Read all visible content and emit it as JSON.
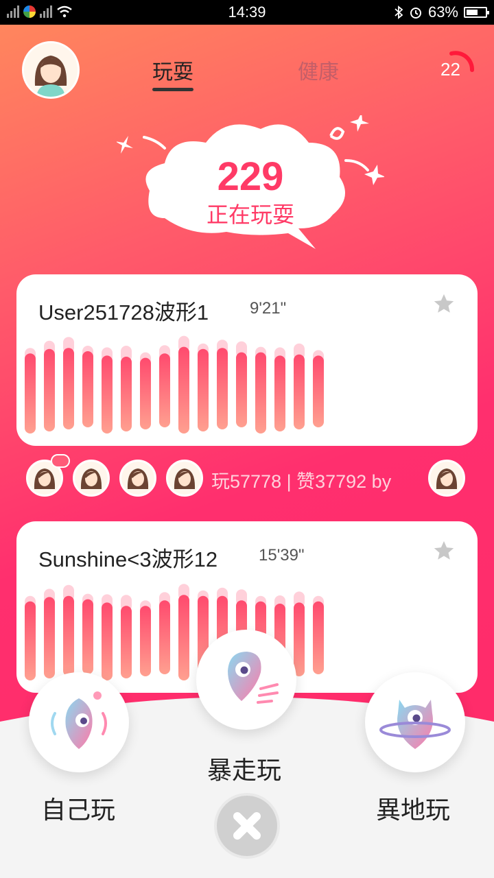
{
  "status_bar": {
    "time": "14:39",
    "battery": "63%",
    "battery_level": 0.63
  },
  "header": {
    "tabs": [
      {
        "label": "玩耍",
        "active": true
      },
      {
        "label": "健康",
        "active": false
      }
    ],
    "counter": "22"
  },
  "hero": {
    "count": "229",
    "label": "正在玩耍"
  },
  "cards": [
    {
      "title": "User251728波形1",
      "duration": "9'21\"",
      "bar_levels": [
        0.73,
        0.77,
        0.78,
        0.75,
        0.71,
        0.7,
        0.69,
        0.73,
        0.79,
        0.77,
        0.78,
        0.74,
        0.74,
        0.71,
        0.72,
        0.71
      ]
    },
    {
      "title": "Sunshine<3波形12",
      "duration": "15'39\"",
      "bar_levels": [
        0.72,
        0.76,
        0.77,
        0.74,
        0.71,
        0.68,
        0.68,
        0.73,
        0.78,
        0.77,
        0.77,
        0.73,
        0.72,
        0.7,
        0.71,
        0.72
      ]
    }
  ],
  "stats": {
    "text": "玩57778 | 赞37792  by"
  },
  "actions": [
    {
      "label": "自己玩",
      "icon": "self-play-icon"
    },
    {
      "label": "暴走玩",
      "icon": "rush-play-icon"
    },
    {
      "label": "異地玩",
      "icon": "remote-play-icon"
    }
  ],
  "colors": {
    "accent": "#ff3a66",
    "bar_top": "#ff4a6e",
    "bar_bottom": "#ffa090"
  }
}
